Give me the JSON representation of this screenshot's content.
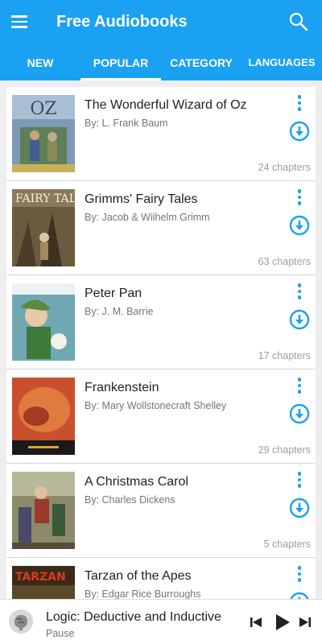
{
  "app": {
    "title": "Free Audiobooks"
  },
  "tabs": [
    {
      "label": "NEW"
    },
    {
      "label": "POPULAR"
    },
    {
      "label": "CATEGORY"
    },
    {
      "label": "LANGUAGES"
    }
  ],
  "books": [
    {
      "title": "The Wonderful Wizard of Oz",
      "author": "By: L. Frank Baum",
      "chapters": "24 chapters"
    },
    {
      "title": "Grimms' Fairy Tales",
      "author": "By: Jacob & Wilhelm Grimm",
      "chapters": "63 chapters"
    },
    {
      "title": "Peter Pan",
      "author": "By: J. M. Barrie",
      "chapters": "17 chapters"
    },
    {
      "title": "Frankenstein",
      "author": "By: Mary Wollstonecraft Shelley",
      "chapters": "29 chapters"
    },
    {
      "title": "A Christmas Carol",
      "author": "By: Charles Dickens",
      "chapters": "5 chapters"
    },
    {
      "title": "Tarzan of the Apes",
      "author": "By: Edgar Rice Burroughs",
      "chapters": ""
    }
  ],
  "covers": {
    "oz": "OZ",
    "grimm": "FAIRY TALES",
    "tarzan": "TARZAN"
  },
  "player": {
    "title": "Logic: Deductive and Inductive",
    "status": "Pause"
  },
  "colors": {
    "accent": "#1ba1f2",
    "background": "#eeeeee"
  }
}
